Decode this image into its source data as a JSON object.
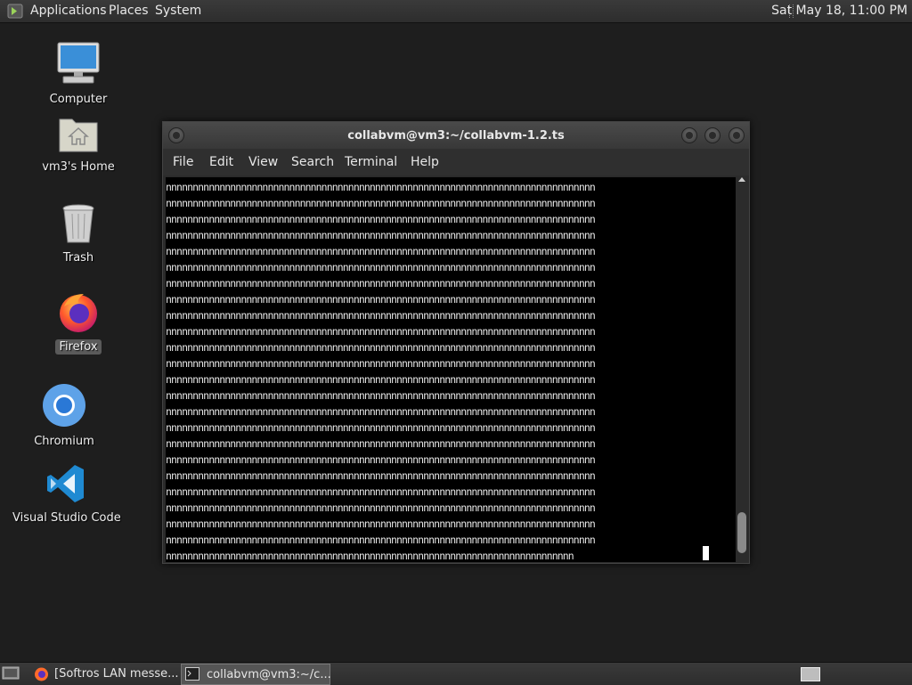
{
  "top_panel": {
    "menus": [
      "Applications",
      "Places",
      "System"
    ],
    "clock": "Sat May 18, 11:00 PM"
  },
  "desktop": {
    "icons": [
      {
        "label": "Computer",
        "icon": "computer-icon"
      },
      {
        "label": "vm3's Home",
        "icon": "home-folder-icon"
      },
      {
        "label": "Trash",
        "icon": "trash-icon"
      },
      {
        "label": "Firefox",
        "icon": "firefox-icon",
        "selected": true
      },
      {
        "label": "Chromium",
        "icon": "chromium-icon"
      },
      {
        "label": "Visual Studio Code",
        "icon": "vscode-icon"
      }
    ]
  },
  "terminal": {
    "title": "collabvm@vm3:~/collabvm-1.2.ts",
    "menu": [
      "File",
      "Edit",
      "View",
      "Search",
      "Terminal",
      "Help"
    ],
    "lines": [
      "nnnnnnnnnnnnnnnnnnnnnnnnnnnnnnnnnnnnnnnnnnnnnnnnnnnnnnnnnnnnnnnnnnnnnnnnnnnnnnnn",
      "nnnnnnnnnnnnnnnnnnnnnnnnnnnnnnnnnnnnnnnnnnnnnnnnnnnnnnnnnnnnnnnnnnnnnnnnnnnnnnnn",
      "nnnnnnnnnnnnnnnnnnnnnnnnnnnnnnnnnnnnnnnnnnnnnnnnnnnnnnnnnnnnnnnnnnnnnnnnnnnnnnnn",
      "nnnnnnnnnnnnnnnnnnnnnnnnnnnnnnnnnnnnnnnnnnnnnnnnnnnnnnnnnnnnnnnnnnnnnnnnnnnnnnnn",
      "nnnnnnnnnnnnnnnnnnnnnnnnnnnnnnnnnnnnnnnnnnnnnnnnnnnnnnnnnnnnnnnnnnnnnnnnnnnnnnnn",
      "nnnnnnnnnnnnnnnnnnnnnnnnnnnnnnnnnnnnnnnnnnnnnnnnnnnnnnnnnnnnnnnnnnnnnnnnnnnnnnnn",
      "nnnnnnnnnnnnnnnnnnnnnnnnnnnnnnnnnnnnnnnnnnnnnnnnnnnnnnnnnnnnnnnnnnnnnnnnnnnnnnnn",
      "nnnnnnnnnnnnnnnnnnnnnnnnnnnnnnnnnnnnnnnnnnnnnnnnnnnnnnnnnnnnnnnnnnnnnnnnnnnnnnnn",
      "nnnnnnnnnnnnnnnnnnnnnnnnnnnnnnnnnnnnnnnnnnnnnnnnnnnnnnnnnnnnnnnnnnnnnnnnnnnnnnnn",
      "nnnnnnnnnnnnnnnnnnnnnnnnnnnnnnnnnnnnnnnnnnnnnnnnnnnnnnnnnnnnnnnnnnnnnnnnnnnnnnnn",
      "nnnnnnnnnnnnnnnnnnnnnnnnnnnnnnnnnnnnnnnnnnnnnnnnnnnnnnnnnnnnnnnnnnnnnnnnnnnnnnnn",
      "nnnnnnnnnnnnnnnnnnnnnnnnnnnnnnnnnnnnnnnnnnnnnnnnnnnnnnnnnnnnnnnnnnnnnnnnnnnnnnnn",
      "nnnnnnnnnnnnnnnnnnnnnnnnnnnnnnnnnnnnnnnnnnnnnnnnnnnnnnnnnnnnnnnnnnnnnnnnnnnnnnnn",
      "nnnnnnnnnnnnnnnnnnnnnnnnnnnnnnnnnnnnnnnnnnnnnnnnnnnnnnnnnnnnnnnnnnnnnnnnnnnnnnnn",
      "nnnnnnnnnnnnnnnnnnnnnnnnnnnnnnnnnnnnnnnnnnnnnnnnnnnnnnnnnnnnnnnnnnnnnnnnnnnnnnnn",
      "nnnnnnnnnnnnnnnnnnnnnnnnnnnnnnnnnnnnnnnnnnnnnnnnnnnnnnnnnnnnnnnnnnnnnnnnnnnnnnnn",
      "nnnnnnnnnnnnnnnnnnnnnnnnnnnnnnnnnnnnnnnnnnnnnnnnnnnnnnnnnnnnnnnnnnnnnnnnnnnnnnnn",
      "nnnnnnnnnnnnnnnnnnnnnnnnnnnnnnnnnnnnnnnnnnnnnnnnnnnnnnnnnnnnnnnnnnnnnnnnnnnnnnnn",
      "nnnnnnnnnnnnnnnnnnnnnnnnnnnnnnnnnnnnnnnnnnnnnnnnnnnnnnnnnnnnnnnnnnnnnnnnnnnnnnnn",
      "nnnnnnnnnnnnnnnnnnnnnnnnnnnnnnnnnnnnnnnnnnnnnnnnnnnnnnnnnnnnnnnnnnnnnnnnnnnnnnnn",
      "nnnnnnnnnnnnnnnnnnnnnnnnnnnnnnnnnnnnnnnnnnnnnnnnnnnnnnnnnnnnnnnnnnnnnnnnnnnnnnnn",
      "nnnnnnnnnnnnnnnnnnnnnnnnnnnnnnnnnnnnnnnnnnnnnnnnnnnnnnnnnnnnnnnnnnnnnnnnnnnnnnnn",
      "nnnnnnnnnnnnnnnnnnnnnnnnnnnnnnnnnnnnnnnnnnnnnnnnnnnnnnnnnnnnnnnnnnnnnnnnnnnnnnnn",
      "nnnnnnnnnnnnnnnnnnnnnnnnnnnnnnnnnnnnnnnnnnnnnnnnnnnnnnnnnnnnnnnnnnnnnnnnnnnn"
    ]
  },
  "taskbar": {
    "tasks": [
      {
        "label": "[Softros LAN messe...",
        "icon": "firefox-icon",
        "active": false
      },
      {
        "label": "collabvm@vm3:~/c...",
        "icon": "terminal-icon",
        "active": true
      }
    ]
  }
}
